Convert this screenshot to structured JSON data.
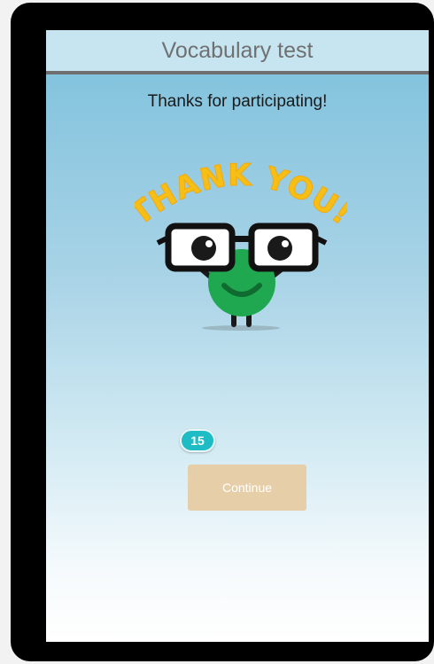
{
  "header": {
    "title": "Vocabulary test"
  },
  "main": {
    "message": "Thanks for participating!",
    "mascot_text": "THANK YOU!",
    "counter_value": "15",
    "continue_label": "Continue"
  },
  "colors": {
    "accent_badge": "#1ebcc4",
    "button_disabled": "#e6cfa8",
    "mascot_green": "#1fa84f",
    "banner_yellow": "#f7bf16"
  }
}
